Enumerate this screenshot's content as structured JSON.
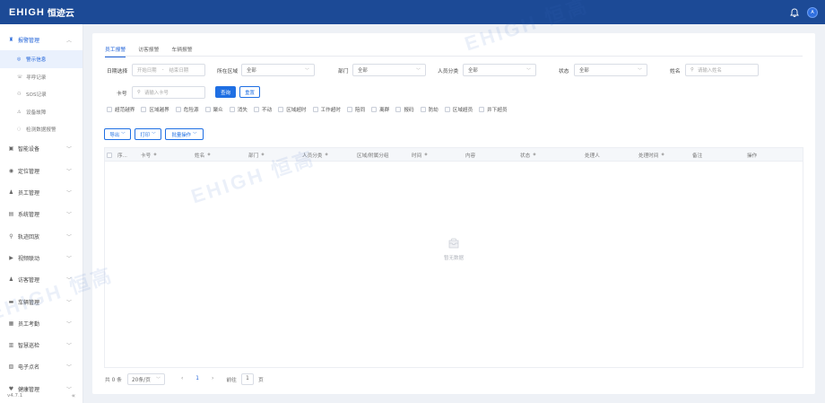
{
  "app": {
    "logo_mark": "EHIGH",
    "logo_text": "恒迹云",
    "avatar_letter": "A"
  },
  "sidebar": {
    "groups": [
      {
        "label": "报警管理",
        "icon": "alarm-icon",
        "open": true,
        "items": [
          {
            "label": "警示信息",
            "icon": "info-icon",
            "active": true
          },
          {
            "label": "寻呼记录",
            "icon": "call-icon"
          },
          {
            "label": "SOS记录",
            "icon": "sos-icon"
          },
          {
            "label": "设备故障",
            "icon": "warning-icon"
          },
          {
            "label": "检测数据报警",
            "icon": "detect-icon"
          }
        ]
      },
      {
        "label": "智能设备",
        "icon": "device-icon"
      },
      {
        "label": "定位管理",
        "icon": "location-icon"
      },
      {
        "label": "员工管理",
        "icon": "user-icon"
      },
      {
        "label": "系统管理",
        "icon": "system-icon"
      },
      {
        "label": "轨迹回放",
        "icon": "track-icon"
      },
      {
        "label": "视频联动",
        "icon": "video-icon"
      },
      {
        "label": "访客管理",
        "icon": "visitor-icon"
      },
      {
        "label": "车辆管理",
        "icon": "car-icon"
      },
      {
        "label": "员工考勤",
        "icon": "attendance-icon"
      },
      {
        "label": "智慧巡检",
        "icon": "inspect-icon"
      },
      {
        "label": "电子点名",
        "icon": "rollcall-icon"
      },
      {
        "label": "健康管理",
        "icon": "health-icon"
      }
    ],
    "version": "v4.7.1",
    "collapse": "«"
  },
  "tabs": [
    {
      "label": "员工报警",
      "active": true
    },
    {
      "label": "访客报警"
    },
    {
      "label": "车辆报警"
    }
  ],
  "filters": {
    "date_label": "日期选择",
    "date_start": "开始日期",
    "date_sep": "-",
    "date_end": "结束日期",
    "area_label": "所在区域",
    "area_value": "全部",
    "dept_label": "部门",
    "dept_value": "全部",
    "category_label": "人员分类",
    "category_value": "全部",
    "status_label": "状态",
    "status_value": "全部",
    "name_label": "姓名",
    "name_placeholder": "请输入姓名",
    "card_label": "卡号",
    "card_placeholder": "请输入卡号",
    "query_button": "查询",
    "reset_button": "重置"
  },
  "alarm_types": [
    "超范越界",
    "区域越界",
    "危险源",
    "聚众",
    "消失",
    "不动",
    "区域超时",
    "工作超时",
    "陪同",
    "离群",
    "报码",
    "防劫",
    "区域超员",
    "井下超员"
  ],
  "actions": {
    "export": "导出",
    "print": "打印",
    "batch": "批量操作"
  },
  "table": {
    "columns": [
      {
        "label": "序...",
        "sortable": false
      },
      {
        "label": "卡号",
        "sortable": true
      },
      {
        "label": "姓名",
        "sortable": true
      },
      {
        "label": "部门",
        "sortable": true
      },
      {
        "label": "人员分类",
        "sortable": true
      },
      {
        "label": "区域/附属分组",
        "sortable": false
      },
      {
        "label": "时间",
        "sortable": true
      },
      {
        "label": "内容",
        "sortable": false
      },
      {
        "label": "状态",
        "sortable": true
      },
      {
        "label": "处理人",
        "sortable": false
      },
      {
        "label": "处理时间",
        "sortable": true
      },
      {
        "label": "备注",
        "sortable": false
      },
      {
        "label": "操作",
        "sortable": false
      }
    ],
    "empty_text": "暂无数据"
  },
  "pagination": {
    "total": "共 0 条",
    "page_size": "20条/页",
    "prev": "‹",
    "page": "1",
    "next": "›",
    "goto_label": "前往",
    "goto_value": "1",
    "page_unit": "页"
  },
  "watermark": {
    "text": "EHIGH 恒高"
  }
}
